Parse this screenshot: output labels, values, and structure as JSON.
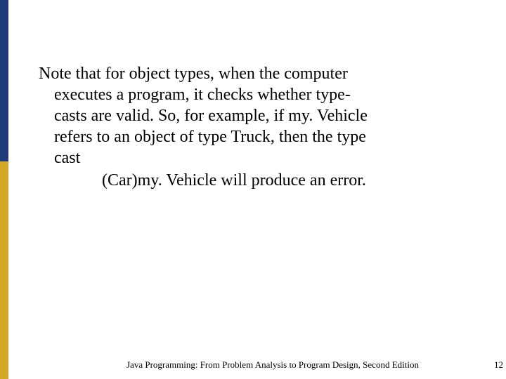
{
  "body": {
    "paragraph": "Note that for object types, when the computer executes a program, it checks whether type-casts are valid. So, for example, if my. Vehicle refers to an object of type Truck, then the type cast",
    "line2": "(Car)my. Vehicle will produce an error."
  },
  "footer": {
    "title": "Java Programming: From Problem Analysis to Program Design, Second Edition",
    "page": "12"
  }
}
